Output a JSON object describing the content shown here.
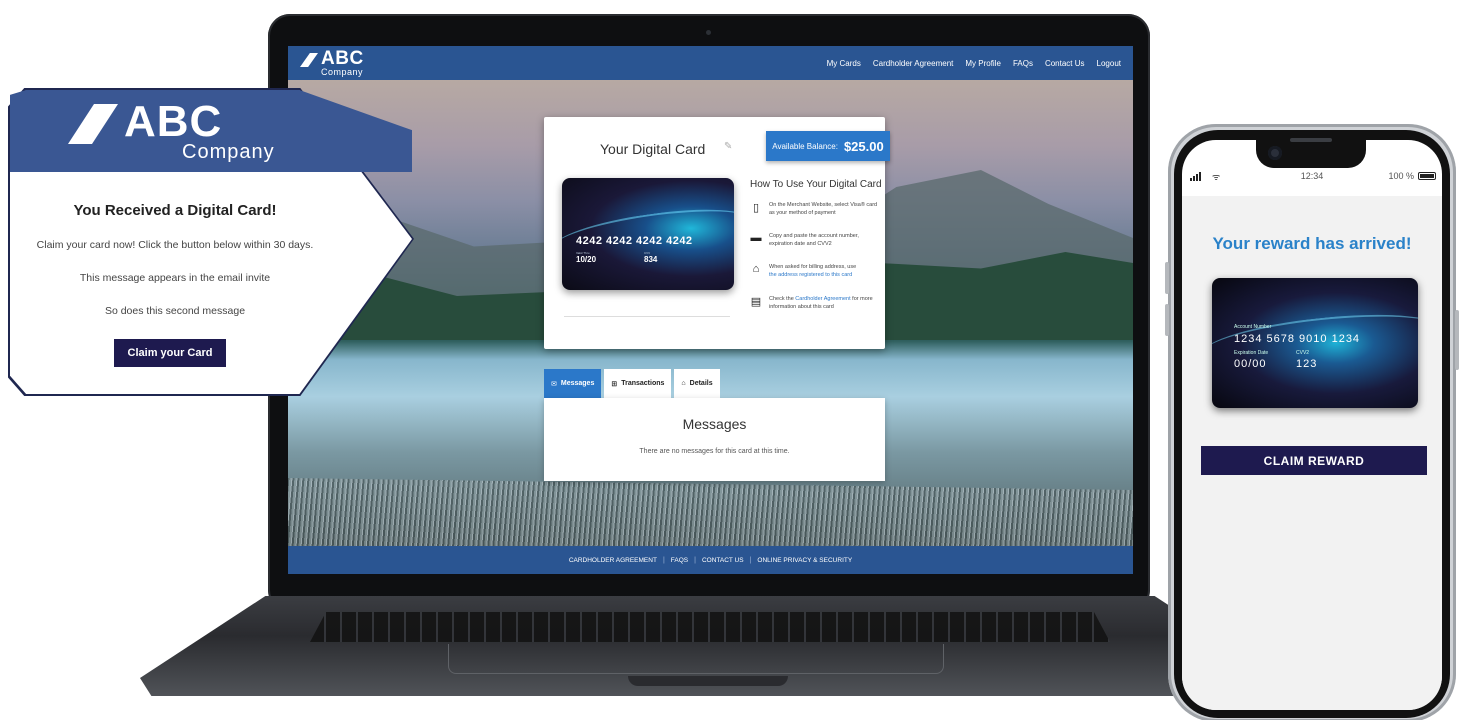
{
  "laptop": {
    "nav": {
      "logo_big": "ABC",
      "logo_small": "Company",
      "links": [
        "My Cards",
        "Cardholder Agreement",
        "My Profile",
        "FAQs",
        "Contact Us",
        "Logout"
      ]
    },
    "card_panel": {
      "title": "Your Digital Card",
      "balance_label": "Available Balance:",
      "balance_value": "$25.00",
      "card_number": "4242 4242 4242 4242",
      "valid_thru_label": "Valid Thru",
      "valid_thru": "10/20",
      "cvv_label": "CVV",
      "cvv": "834",
      "howto_title": "How To Use Your Digital Card",
      "howto": [
        {
          "icon": "phone-icon",
          "text": "On the Merchant Website, select Visa® card as your method of payment"
        },
        {
          "icon": "credit-card-icon",
          "text": "Copy and paste the account number, expiration date and CVV2"
        },
        {
          "icon": "home-icon",
          "text": "When asked for billing address, use",
          "link": "the address registered to this card"
        },
        {
          "icon": "document-icon",
          "text": "Check the",
          "link": "Cardholder Agreement",
          "text_after": "for more information about this card"
        }
      ]
    },
    "tabs": [
      {
        "label": "Messages",
        "icon": "envelope-icon",
        "active": true
      },
      {
        "label": "Transactions",
        "icon": "basket-icon",
        "active": false
      },
      {
        "label": "Details",
        "icon": "home-icon",
        "active": false
      }
    ],
    "messages": {
      "title": "Messages",
      "empty_text": "There are no messages for this card at this time."
    },
    "footer": [
      "CARDHOLDER AGREEMENT",
      "FAQS",
      "CONTACT US",
      "ONLINE PRIVACY & SECURITY"
    ]
  },
  "email": {
    "logo_big": "ABC",
    "logo_small": "Company",
    "heading": "You Received a Digital Card!",
    "line1": "Claim your card now! Click the button below within 30 days.",
    "line2": "This message appears in the email invite",
    "line3": "So does this second message",
    "button": "Claim your Card"
  },
  "phone": {
    "time": "12:34",
    "battery": "100 %",
    "title": "Your reward has arrived!",
    "account_number_label": "Account Number",
    "account_number": "1234 5678 9010 1234",
    "expiration_label": "Expiration Date",
    "expiration": "00/00",
    "cvv2_label": "CVV2",
    "cvv2": "123",
    "button": "CLAIM REWARD"
  },
  "colors": {
    "nav_blue": "#2a5592",
    "accent_blue": "#2b78c9",
    "button_navy": "#1e1a4f",
    "email_header": "#3a5793",
    "reward_title": "#2a82c9"
  }
}
